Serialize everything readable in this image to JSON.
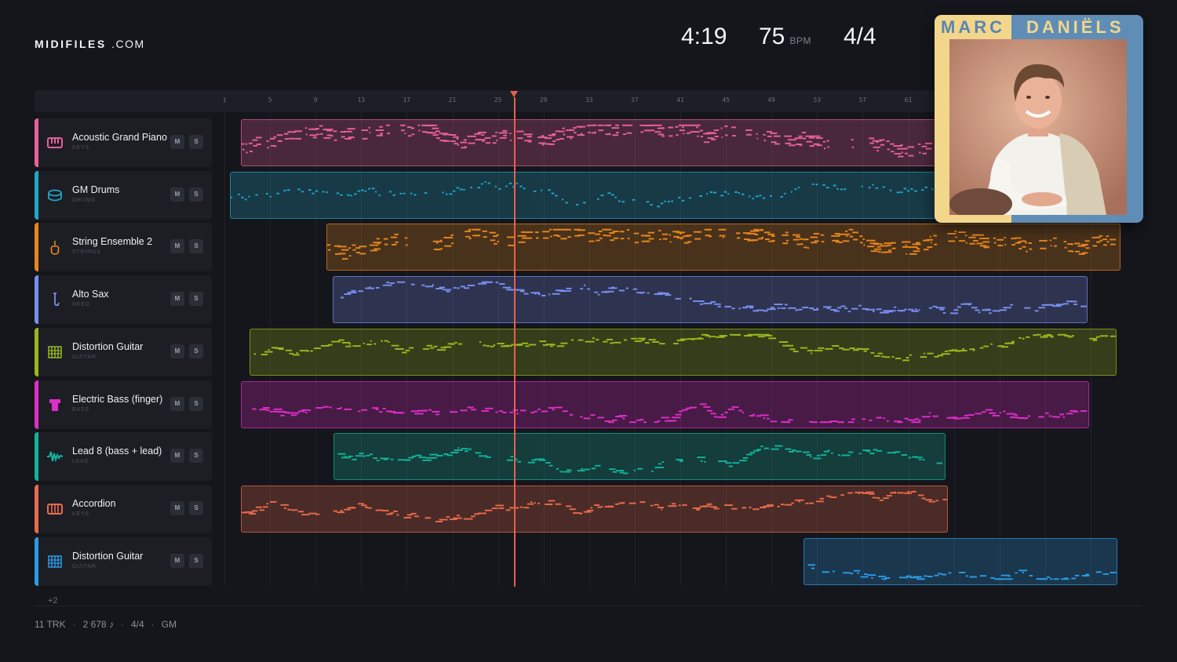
{
  "brand": {
    "bold": "MIDIFILES",
    "light": ".COM"
  },
  "transport": {
    "time": "4:19",
    "bpm": "75",
    "bpm_unit": "BPM",
    "meter": "4/4"
  },
  "ruler": {
    "bars": [
      "1",
      "5",
      "9",
      "13",
      "17",
      "21",
      "25",
      "29",
      "33",
      "37",
      "41",
      "45",
      "49",
      "53",
      "57",
      "61"
    ]
  },
  "tracks": [
    {
      "name": "Acoustic Grand Piano",
      "category": "KEYS",
      "color": "#e8609a",
      "icon": "piano-keys-icon"
    },
    {
      "name": "GM Drums",
      "category": "DRUMS",
      "color": "#1fa7c9",
      "icon": "drum-icon"
    },
    {
      "name": "String Ensemble 2",
      "category": "STRINGS",
      "color": "#e8861c",
      "icon": "violin-icon"
    },
    {
      "name": "Alto Sax",
      "category": "REED",
      "color": "#7a8ef0",
      "icon": "saxophone-icon"
    },
    {
      "name": "Distortion Guitar",
      "category": "GUITAR",
      "color": "#98b81c",
      "icon": "guitar-fretboard-icon"
    },
    {
      "name": "Electric Bass (finger)",
      "category": "BASS",
      "color": "#e02dc9",
      "icon": "bass-amp-icon"
    },
    {
      "name": "Lead 8 (bass + lead)",
      "category": "LEAD",
      "color": "#12b39a",
      "icon": "waveform-icon"
    },
    {
      "name": "Accordion",
      "category": "KEYS",
      "color": "#ea6a4c",
      "icon": "accordion-icon"
    },
    {
      "name": "Distortion Guitar",
      "category": "GUITAR",
      "color": "#2a9be6",
      "icon": "guitar-fretboard-icon"
    }
  ],
  "buttons": {
    "mute": "M",
    "solo": "S"
  },
  "more_tracks": "+2",
  "footer": {
    "tracks": "11 TRK",
    "notes": "2 678 ♪",
    "meter": "4/4",
    "standard": "GM"
  },
  "cover": {
    "artist_first": "MARC",
    "artist_last": "DANIËLS"
  }
}
